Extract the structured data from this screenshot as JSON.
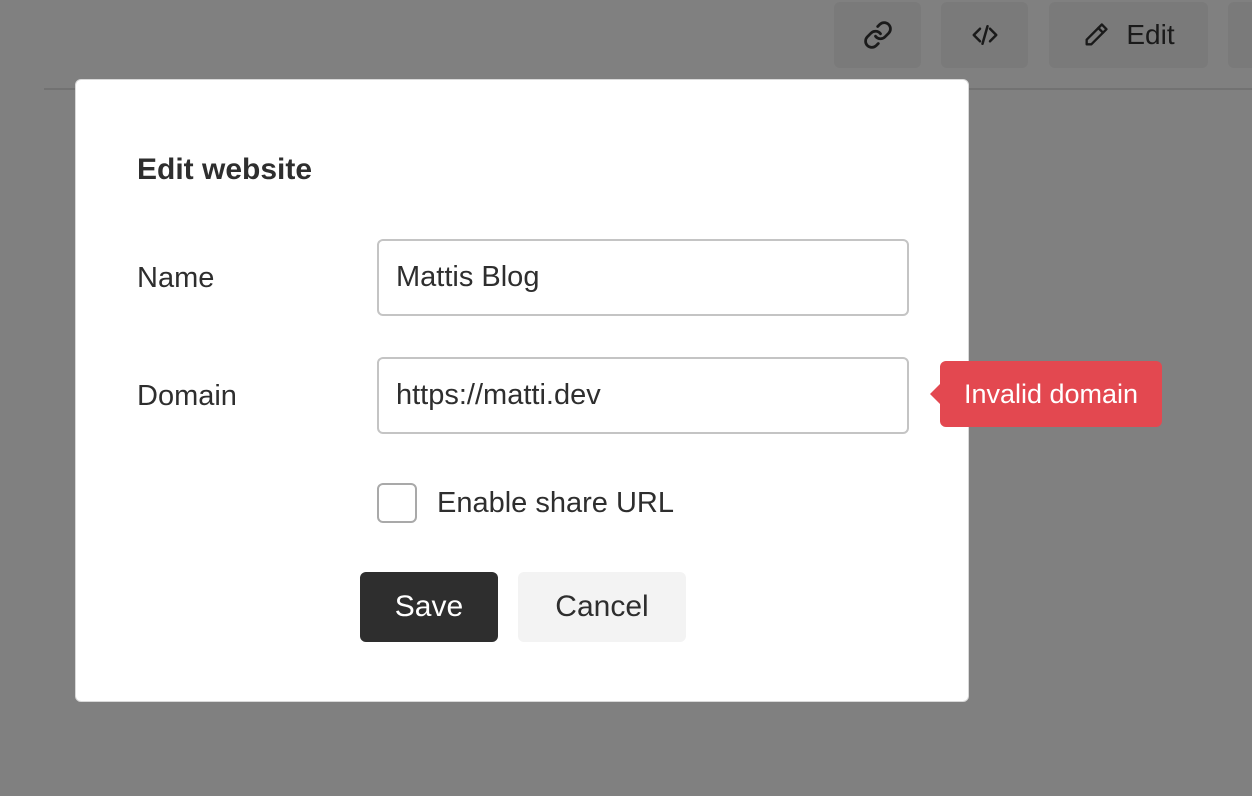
{
  "toolbar": {
    "link_icon": "link-icon",
    "code_icon": "code-icon",
    "edit_icon": "pencil-icon",
    "edit_label": "Edit"
  },
  "modal": {
    "title": "Edit website",
    "fields": {
      "name": {
        "label": "Name",
        "value": "Mattis Blog"
      },
      "domain": {
        "label": "Domain",
        "value": "https://matti.dev",
        "error": "Invalid domain"
      }
    },
    "share_checkbox": {
      "label": "Enable share URL",
      "checked": false
    },
    "buttons": {
      "save": "Save",
      "cancel": "Cancel"
    }
  },
  "colors": {
    "overlay": "#808080",
    "primary_button": "#2e2e2e",
    "secondary_button": "#f3f3f3",
    "error": "#e34850"
  }
}
